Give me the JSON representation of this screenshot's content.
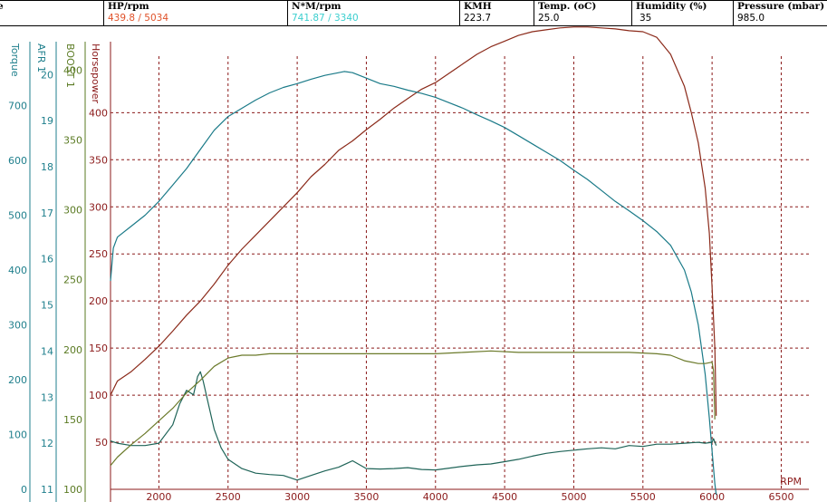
{
  "header": {
    "columns": [
      {
        "label": "e",
        "value": ""
      },
      {
        "label": "HP/rpm",
        "value": "439.8 / 5034",
        "color": "#e0522a"
      },
      {
        "label": "N*M/rpm",
        "value": "741.87 / 3340",
        "color": "#3ccfcf"
      },
      {
        "label": "KMH",
        "value": "223.7",
        "color": "#000000"
      },
      {
        "label": "Temp. (oC)",
        "value": "25.0",
        "color": "#000000"
      },
      {
        "label": "Humidity (%)",
        "value": "35",
        "color": "#000000"
      },
      {
        "label": "Pressure (mbar)",
        "value": "985.0",
        "color": "#000000"
      }
    ]
  },
  "chart_data": {
    "type": "line",
    "x_label": "RPM",
    "x_range": [
      1650,
      6700
    ],
    "x_ticks": [
      "2000",
      "2500",
      "3000",
      "3500",
      "4000",
      "4500",
      "5000",
      "5500",
      "6000",
      "6500"
    ],
    "grid": true,
    "grid_color": "#8b1a1a",
    "axes": [
      {
        "name": "Torque",
        "color": "#1f7f8c",
        "range": [
          0,
          790
        ],
        "ticks": [
          "0",
          "100",
          "200",
          "300",
          "400",
          "500",
          "600",
          "700"
        ]
      },
      {
        "name": "AFR 1",
        "color": "#1f7f8c",
        "range": [
          11,
          20.4
        ],
        "ticks": [
          "11",
          "12",
          "13",
          "14",
          "15",
          "16",
          "17",
          "18",
          "19",
          "20"
        ]
      },
      {
        "name": "BOOST 1",
        "color": "#5a7a22",
        "range": [
          100,
          410
        ],
        "ticks": [
          "100",
          "150",
          "200",
          "250",
          "300",
          "350",
          "400"
        ]
      },
      {
        "name": "Horsepower",
        "color": "#8b1a1a",
        "range": [
          0,
          460
        ],
        "ticks": [
          "50",
          "100",
          "150",
          "200",
          "250",
          "300",
          "350",
          "400"
        ]
      }
    ],
    "series": [
      {
        "name": "Horsepower",
        "axis": "Horsepower",
        "color": "#8b2a1a",
        "x": [
          1650,
          1700,
          1800,
          1900,
          2000,
          2100,
          2200,
          2300,
          2400,
          2500,
          2600,
          2700,
          2800,
          2900,
          3000,
          3100,
          3200,
          3300,
          3400,
          3500,
          3600,
          3700,
          3800,
          3900,
          4000,
          4100,
          4200,
          4300,
          4400,
          4500,
          4600,
          4700,
          4800,
          4900,
          5000,
          5100,
          5200,
          5300,
          5400,
          5500,
          5600,
          5700,
          5800,
          5850,
          5900,
          5950,
          5980,
          6000,
          6020,
          6030
        ],
        "y": [
          100,
          115,
          125,
          138,
          152,
          168,
          185,
          200,
          218,
          238,
          255,
          270,
          285,
          300,
          315,
          332,
          345,
          360,
          370,
          382,
          393,
          405,
          415,
          425,
          432,
          442,
          452,
          462,
          470,
          476,
          482,
          486,
          488,
          490,
          491,
          491,
          490,
          489,
          487,
          486,
          480,
          462,
          428,
          400,
          368,
          320,
          272,
          215,
          150,
          78
        ]
      },
      {
        "name": "Torque",
        "axis": "Torque",
        "color": "#1a7a88",
        "x": [
          1650,
          1670,
          1700,
          1800,
          1900,
          2000,
          2100,
          2200,
          2300,
          2400,
          2500,
          2600,
          2700,
          2800,
          2900,
          3000,
          3100,
          3200,
          3300,
          3340,
          3400,
          3500,
          3600,
          3700,
          3800,
          3900,
          4000,
          4100,
          4200,
          4300,
          4400,
          4500,
          4600,
          4700,
          4800,
          4900,
          5000,
          5100,
          5200,
          5300,
          5400,
          5500,
          5600,
          5700,
          5800,
          5850,
          5900,
          5950,
          5980,
          6000,
          6020,
          6030
        ],
        "y": [
          380,
          440,
          460,
          480,
          500,
          525,
          555,
          585,
          620,
          655,
          680,
          695,
          710,
          723,
          733,
          740,
          748,
          755,
          760,
          762,
          760,
          750,
          740,
          735,
          728,
          722,
          715,
          705,
          695,
          683,
          672,
          660,
          645,
          630,
          615,
          600,
          582,
          565,
          545,
          525,
          508,
          490,
          470,
          445,
          400,
          360,
          300,
          210,
          130,
          70,
          10,
          -10
        ]
      },
      {
        "name": "AFR 1",
        "axis": "AFR 1",
        "color": "#1f6458",
        "x": [
          1650,
          1700,
          1800,
          1900,
          2000,
          2100,
          2150,
          2200,
          2250,
          2280,
          2300,
          2320,
          2350,
          2400,
          2450,
          2500,
          2600,
          2700,
          2800,
          2900,
          3000,
          3100,
          3200,
          3300,
          3400,
          3500,
          3600,
          3700,
          3800,
          3900,
          4000,
          4100,
          4200,
          4300,
          4400,
          4500,
          4600,
          4700,
          4800,
          4900,
          5000,
          5100,
          5200,
          5300,
          5400,
          5500,
          5600,
          5700,
          5800,
          5900,
          5950,
          6000,
          6010,
          6030
        ],
        "y": [
          12.05,
          12.0,
          11.95,
          11.95,
          12.0,
          12.4,
          12.85,
          13.15,
          13.05,
          13.45,
          13.55,
          13.35,
          12.95,
          12.3,
          11.9,
          11.65,
          11.45,
          11.35,
          11.32,
          11.3,
          11.2,
          11.3,
          11.4,
          11.48,
          11.62,
          11.45,
          11.44,
          11.45,
          11.47,
          11.43,
          11.42,
          11.46,
          11.5,
          11.53,
          11.55,
          11.6,
          11.65,
          11.72,
          11.78,
          11.82,
          11.85,
          11.88,
          11.9,
          11.88,
          11.95,
          11.93,
          11.98,
          11.98,
          12.0,
          12.02,
          12.0,
          12.02,
          12.1,
          11.95
        ]
      },
      {
        "name": "BOOST 1",
        "axis": "BOOST 1",
        "color": "#6b7a2a",
        "x": [
          1650,
          1700,
          1800,
          1900,
          2000,
          2100,
          2200,
          2300,
          2400,
          2500,
          2600,
          2700,
          2800,
          2900,
          3000,
          3200,
          3400,
          3600,
          3800,
          4000,
          4200,
          4400,
          4600,
          4800,
          5000,
          5200,
          5400,
          5600,
          5700,
          5800,
          5900,
          5950,
          6000,
          6010,
          6020
        ],
        "y": [
          117,
          123,
          132,
          140,
          149,
          158,
          169,
          178,
          188,
          194,
          196,
          196,
          197,
          197,
          197,
          197,
          197,
          197,
          197,
          197,
          198,
          199,
          198,
          198,
          198,
          198,
          198,
          197,
          196,
          192,
          190,
          190,
          191,
          185,
          150
        ]
      }
    ]
  }
}
